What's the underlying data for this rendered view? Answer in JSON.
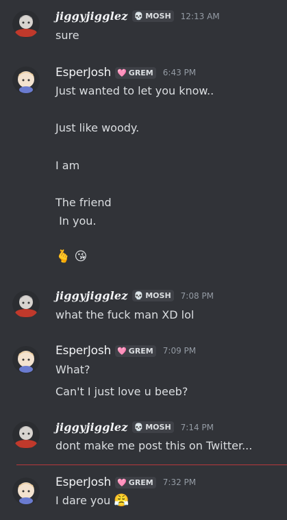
{
  "messages": [
    {
      "author": "jiggyjigglez",
      "tag": "MOSH",
      "tag_icon": "skull-icon",
      "time": "12:13 AM",
      "lines": [
        "sure"
      ]
    },
    {
      "author": "EsperJosh",
      "tag": "GREM",
      "tag_icon": "heart-icon",
      "time": "6:43 PM",
      "lines": [
        "Just wanted to let you know..",
        "Just like woody.",
        "I am",
        "The friend",
        " In you."
      ],
      "emojis": [
        "🫰",
        "😘"
      ]
    },
    {
      "author": "jiggyjigglez",
      "tag": "MOSH",
      "tag_icon": "skull-icon",
      "time": "7:08 PM",
      "lines": [
        "what the fuck man XD lol"
      ]
    },
    {
      "author": "EsperJosh",
      "tag": "GREM",
      "tag_icon": "heart-icon",
      "time": "7:09 PM",
      "lines": [
        "What?",
        "Can't I just love u beeb?"
      ]
    },
    {
      "author": "jiggyjigglez",
      "tag": "MOSH",
      "tag_icon": "skull-icon",
      "time": "7:14 PM",
      "lines": [
        "dont make me post this on Twitter..."
      ]
    },
    {
      "author": "EsperJosh",
      "tag": "GREM",
      "tag_icon": "heart-icon",
      "time": "7:32 PM",
      "lines": [
        "I dare you"
      ],
      "emojis": [
        "😤"
      ]
    }
  ],
  "colors": {
    "background": "#313338",
    "new_divider": "#b8383b",
    "timestamp": "#949ba4"
  }
}
